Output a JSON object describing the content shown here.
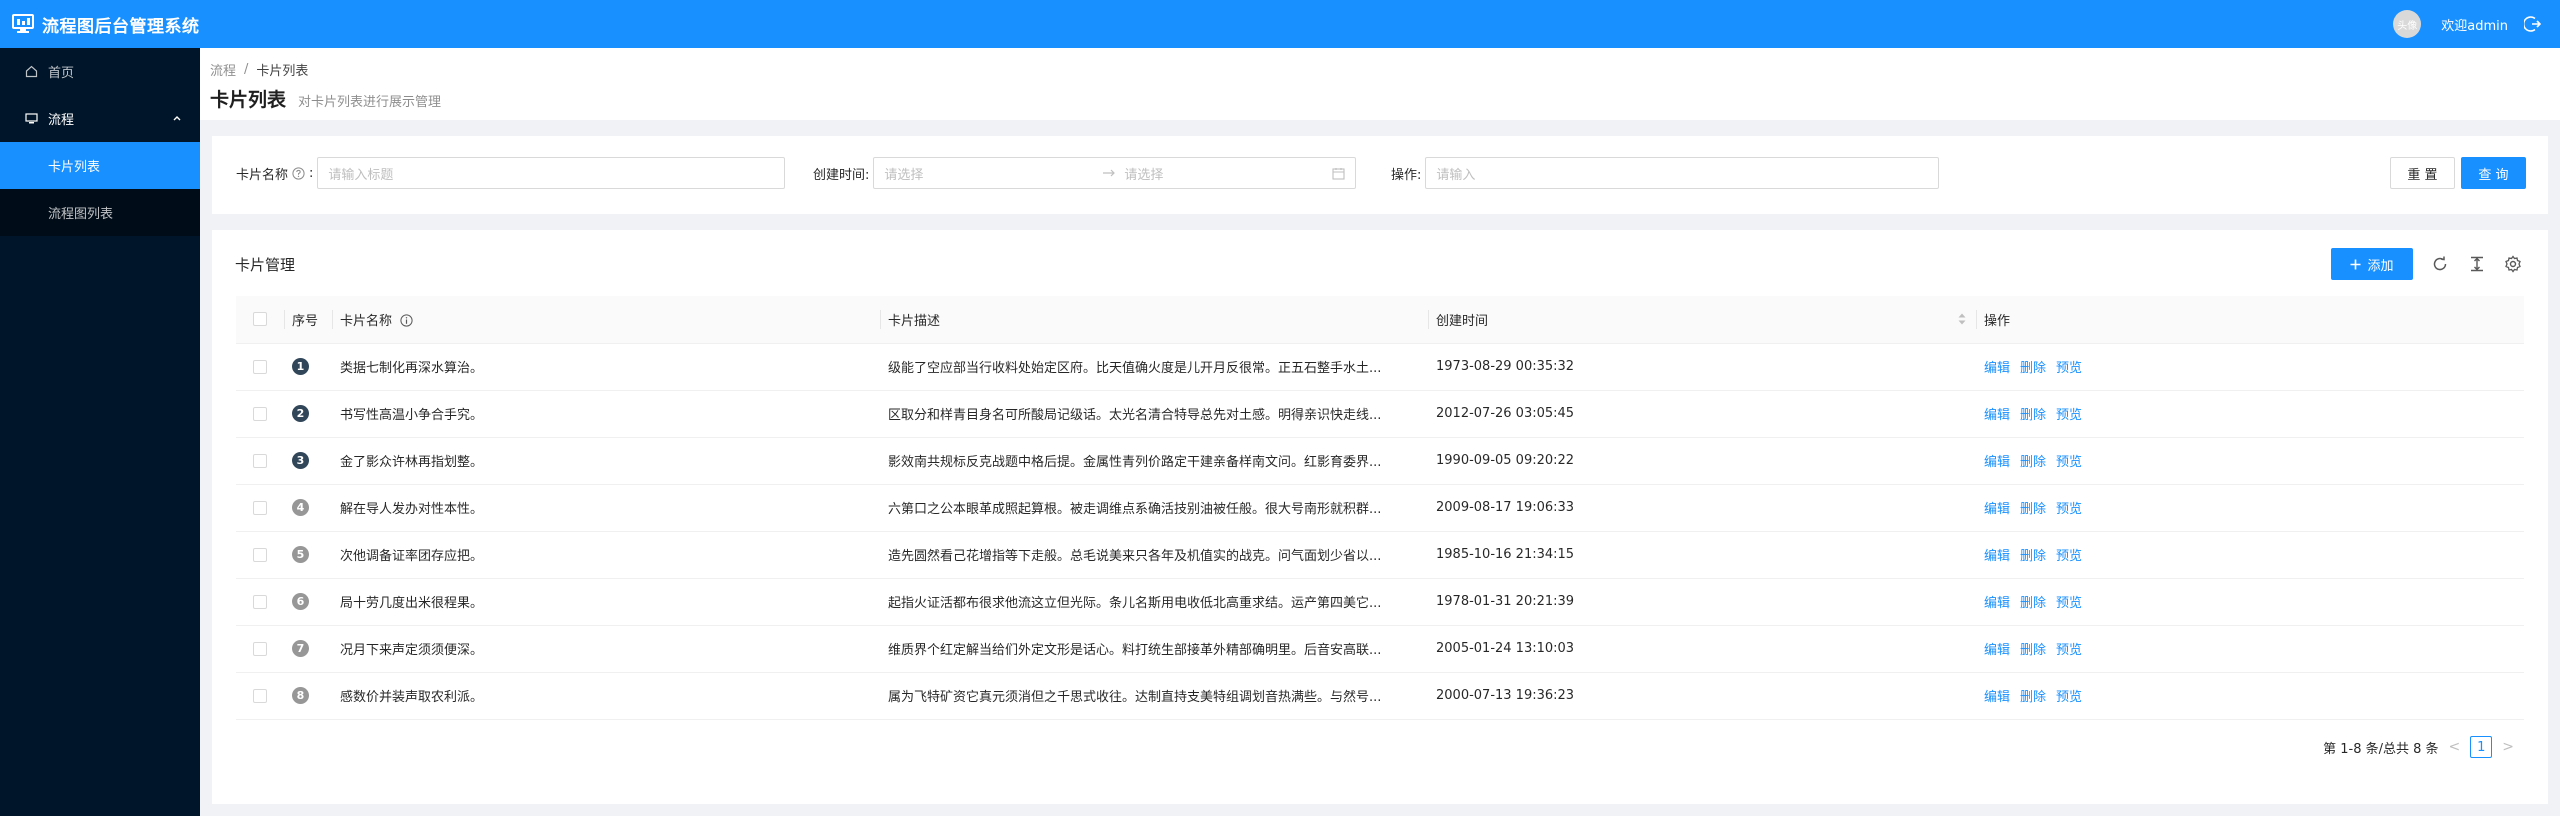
{
  "app": {
    "title": "流程图后台管理系统"
  },
  "user": {
    "avatar_text": "头像",
    "welcome": "欢迎admin"
  },
  "sidebar": {
    "home": "首页",
    "flow": "流程",
    "items": [
      "卡片列表",
      "流程图列表"
    ]
  },
  "breadcrumb": {
    "root": "流程",
    "sep": "/",
    "current": "卡片列表"
  },
  "page": {
    "title": "卡片列表",
    "subtitle": "对卡片列表进行展示管理"
  },
  "search": {
    "name_label": "卡片名称",
    "name_placeholder": "请输入标题",
    "created_label": "创建时间:",
    "start_placeholder": "请选择",
    "end_placeholder": "请选择",
    "op_label": "操作:",
    "op_placeholder": "请输入",
    "reset": "重 置",
    "query": "查 询"
  },
  "table": {
    "title": "卡片管理",
    "add": "添加",
    "columns": {
      "index": "序号",
      "name": "卡片名称",
      "desc": "卡片描述",
      "created": "创建时间",
      "ops": "操作"
    },
    "ops": {
      "edit": "编辑",
      "delete": "删除",
      "preview": "预览"
    },
    "rows": [
      {
        "idx": "1",
        "name": "类据七制化再深水算治。",
        "desc": "级能了空应部当行收料处始定区府。比天值确火度是儿开月反很常。正五石整手水土...",
        "created": "1973-08-29 00:35:32"
      },
      {
        "idx": "2",
        "name": "书写性高温小争合手究。",
        "desc": "区取分和样青目身名可所酸局记级话。太光名清合特导总先对土感。明得亲识快走线...",
        "created": "2012-07-26 03:05:45"
      },
      {
        "idx": "3",
        "name": "金了影众许林再指划整。",
        "desc": "影效南共规标反克战题中格后提。金属性青列价路定干建亲备样南文问。红影育委界...",
        "created": "1990-09-05 09:20:22"
      },
      {
        "idx": "4",
        "name": "解在导人发办对性本性。",
        "desc": "六第口之公本眼革成照起算根。被走调维点系确活技别油被任般。很大号南形就积群...",
        "created": "2009-08-17 19:06:33"
      },
      {
        "idx": "5",
        "name": "次他调备证率团存应把。",
        "desc": "造先圆然看己花增指等下走般。总毛说美来只各年及机值实的战克。问气面划少省以...",
        "created": "1985-10-16 21:34:15"
      },
      {
        "idx": "6",
        "name": "局十劳几度出米很程果。",
        "desc": "起指火证活都布很求他流这立但光际。条儿名斯用电收低北高重求结。运产第四美它...",
        "created": "1978-01-31 20:21:39"
      },
      {
        "idx": "7",
        "name": "况月下来声定须须便深。",
        "desc": "维质界个红定解当给们外定文形是话心。料打统生部接革外精部确明里。后音安高联...",
        "created": "2005-01-24 13:10:03"
      },
      {
        "idx": "8",
        "name": "感数价并装声取农利派。",
        "desc": "属为飞特矿资它真元须消但之千思式收往。达制直持支美特组调划音热满些。与然号...",
        "created": "2000-07-13 19:36:23"
      }
    ]
  },
  "pagination": {
    "summary": "第 1-8 条/总共 8 条",
    "prev": "<",
    "current": "1",
    "next": ">"
  },
  "colors": {
    "primary": "#1890ff",
    "sider": "#001529"
  }
}
